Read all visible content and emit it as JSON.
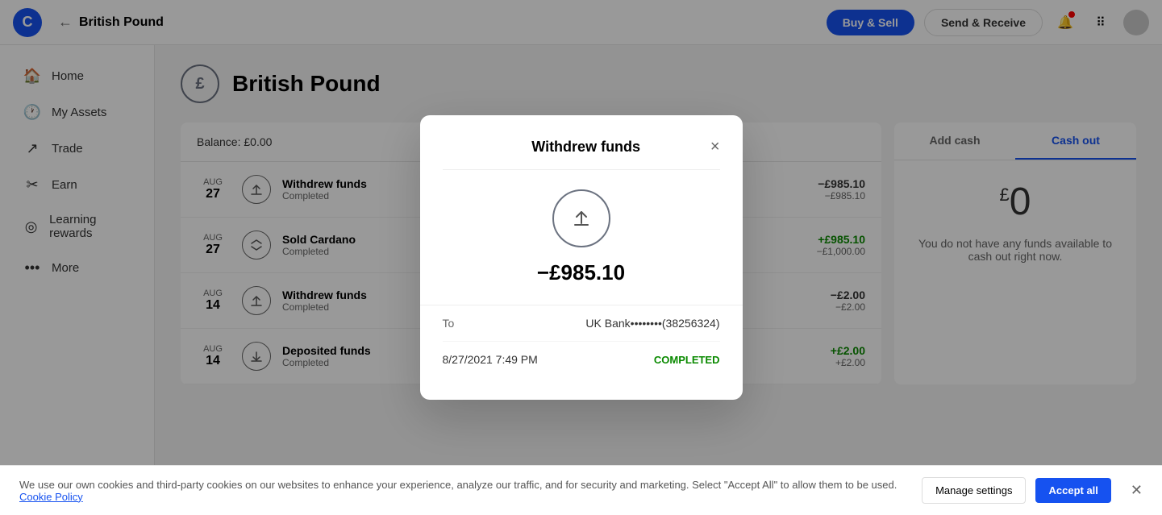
{
  "app": {
    "logo": "C",
    "nav_title": "British Pound"
  },
  "topnav": {
    "back_icon": "←",
    "title": "British Pound",
    "buy_sell_label": "Buy & Sell",
    "send_receive_label": "Send & Receive"
  },
  "sidebar": {
    "items": [
      {
        "id": "home",
        "icon": "⌂",
        "label": "Home"
      },
      {
        "id": "my-assets",
        "icon": "◷",
        "label": "My Assets"
      },
      {
        "id": "trade",
        "icon": "↗",
        "label": "Trade"
      },
      {
        "id": "earn",
        "icon": "%",
        "label": "Earn"
      },
      {
        "id": "learning-rewards",
        "icon": "◎",
        "label": "Learning rewards"
      },
      {
        "id": "more",
        "icon": "⋯",
        "label": "More"
      }
    ]
  },
  "asset": {
    "icon": "£",
    "title": "British Pound"
  },
  "balance": {
    "label": "Balance: £0.00"
  },
  "transactions": [
    {
      "month": "AUG",
      "day": "27",
      "name": "Withdrew funds",
      "status": "Completed",
      "icon_type": "upload",
      "primary_amount": "−£985.10",
      "secondary_amount": "−£985.10",
      "is_positive": false
    },
    {
      "month": "AUG",
      "day": "27",
      "name": "Sold Cardano",
      "status": "Completed",
      "icon_type": "swap",
      "primary_amount": "+£985.10",
      "secondary_amount": "−£1,000.00",
      "is_positive": true
    },
    {
      "month": "AUG",
      "day": "14",
      "name": "Withdrew funds",
      "status": "Completed",
      "icon_type": "upload",
      "primary_amount": "−£2.00",
      "secondary_amount": "−£2.00",
      "is_positive": false
    },
    {
      "month": "AUG",
      "day": "14",
      "name": "Deposited funds",
      "status": "Completed",
      "icon_type": "download",
      "primary_amount": "+£2.00",
      "secondary_amount": "+£2.00",
      "is_positive": true
    }
  ],
  "right_panel": {
    "tab_add_cash": "Add cash",
    "tab_cash_out": "Cash out",
    "active_tab": "cash_out",
    "amount": "0",
    "amount_currency": "£",
    "no_funds_text": "You do not have any funds available to cash out right now."
  },
  "modal": {
    "title": "Withdrew funds",
    "close_icon": "×",
    "amount": "−£985.10",
    "to_label": "To",
    "to_value": "UK Bank••••••••(38256324)",
    "datetime": "8/27/2021 7:49 PM",
    "status": "COMPLETED"
  },
  "cookie": {
    "text": "We use our own cookies and third-party cookies on our websites to enhance your experience, analyze our traffic, and for security and marketing. Select \"Accept All\" to allow them to be used.",
    "link_text": "Cookie Policy",
    "manage_label": "Manage settings",
    "accept_label": "Accept all"
  }
}
